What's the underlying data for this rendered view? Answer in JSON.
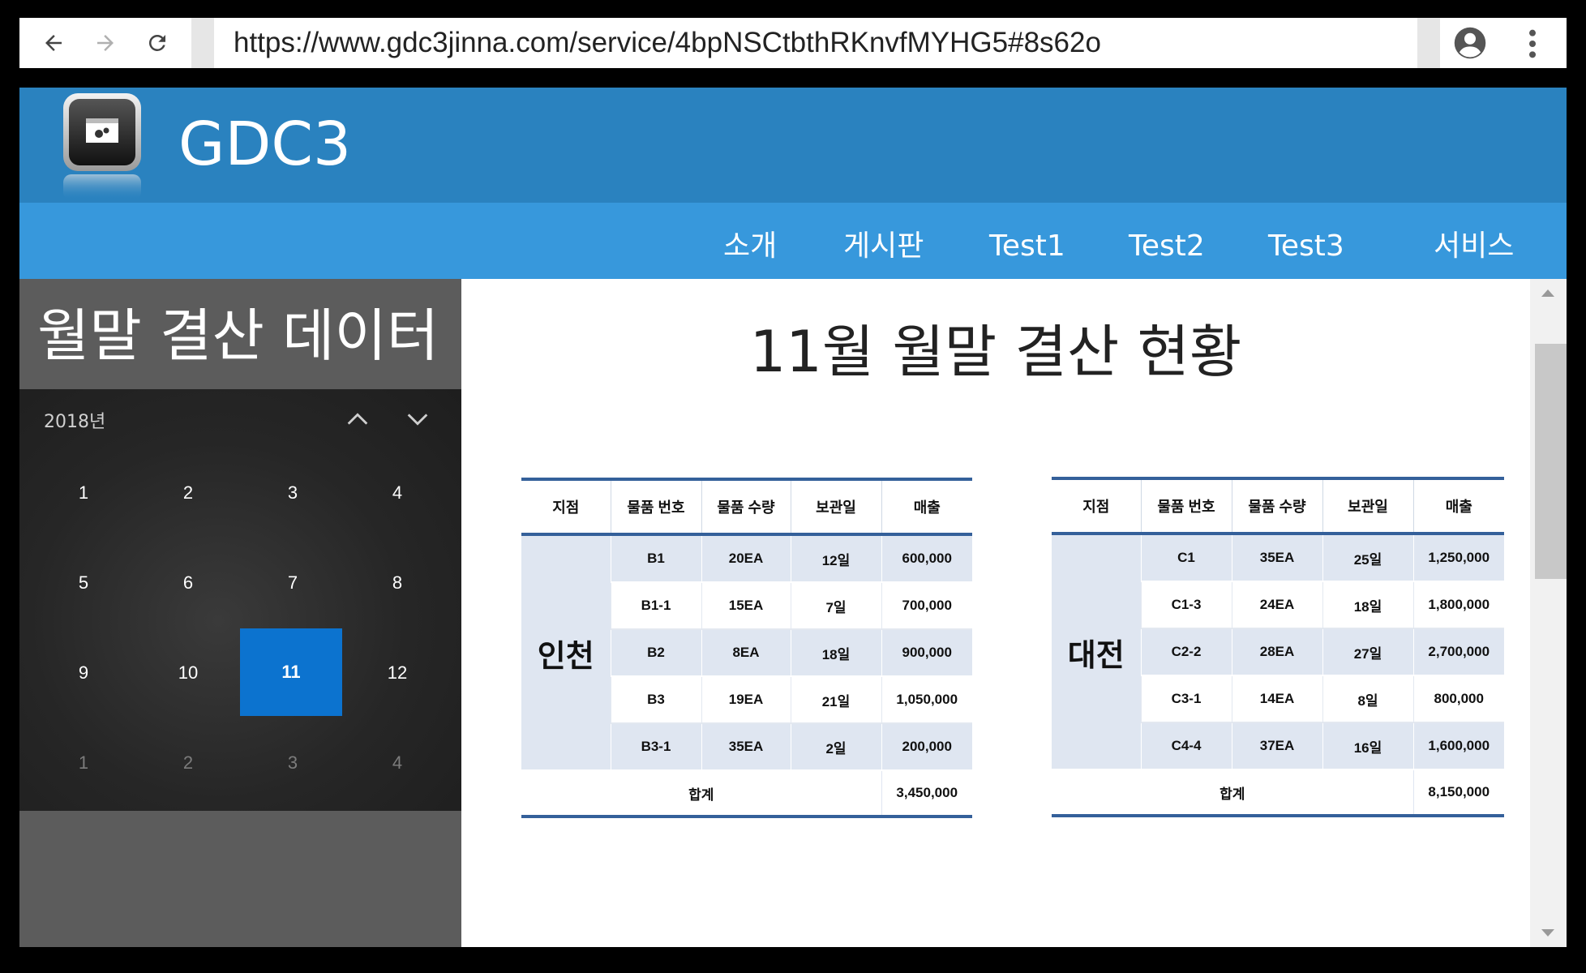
{
  "browser": {
    "url": "https://www.gdc3jinna.com/service/4bpNSCtbthRKnvfMYHG5#8s62o"
  },
  "header": {
    "brand": "GDC3"
  },
  "nav": {
    "items": [
      "소개",
      "게시판",
      "Test1",
      "Test2",
      "Test3",
      "서비스"
    ]
  },
  "sidebar": {
    "title": "월말 결산 데이터",
    "calendar": {
      "year": "2018년",
      "months": [
        [
          "1",
          "2",
          "3",
          "4"
        ],
        [
          "5",
          "6",
          "7",
          "8"
        ],
        [
          "9",
          "10",
          "11",
          "12"
        ],
        [
          "1",
          "2",
          "3",
          "4"
        ]
      ],
      "selected": "11"
    }
  },
  "main": {
    "title": "11월 월말 결산 현황",
    "headers": [
      "지점",
      "물품 번호",
      "물품 수량",
      "보관일",
      "매출"
    ],
    "total_label": "합계",
    "tables": [
      {
        "region": "인천",
        "rows": [
          [
            "B1",
            "20EA",
            "12일",
            "600,000"
          ],
          [
            "B1-1",
            "15EA",
            "7일",
            "700,000"
          ],
          [
            "B2",
            "8EA",
            "18일",
            "900,000"
          ],
          [
            "B3",
            "19EA",
            "21일",
            "1,050,000"
          ],
          [
            "B3-1",
            "35EA",
            "2일",
            "200,000"
          ]
        ],
        "total": "3,450,000"
      },
      {
        "region": "대전",
        "rows": [
          [
            "C1",
            "35EA",
            "25일",
            "1,250,000"
          ],
          [
            "C1-3",
            "24EA",
            "18일",
            "1,800,000"
          ],
          [
            "C2-2",
            "28EA",
            "27일",
            "2,700,000"
          ],
          [
            "C3-1",
            "14EA",
            "8일",
            "800,000"
          ],
          [
            "C4-4",
            "37EA",
            "16일",
            "1,600,000"
          ]
        ],
        "total": "8,150,000"
      }
    ]
  },
  "colors": {
    "header": "#2a82bf",
    "navbar": "#3798dc",
    "sidebar": "#5c5c5c",
    "calendar_selected": "#0c73cf",
    "table_rule": "#34609a",
    "table_fill": "#dfe6f1"
  },
  "icons": [
    "back-arrow-icon",
    "forward-arrow-icon",
    "reload-icon",
    "account-icon",
    "more-vert-icon",
    "app-logo-icon",
    "chevron-up-icon",
    "chevron-down-icon"
  ]
}
